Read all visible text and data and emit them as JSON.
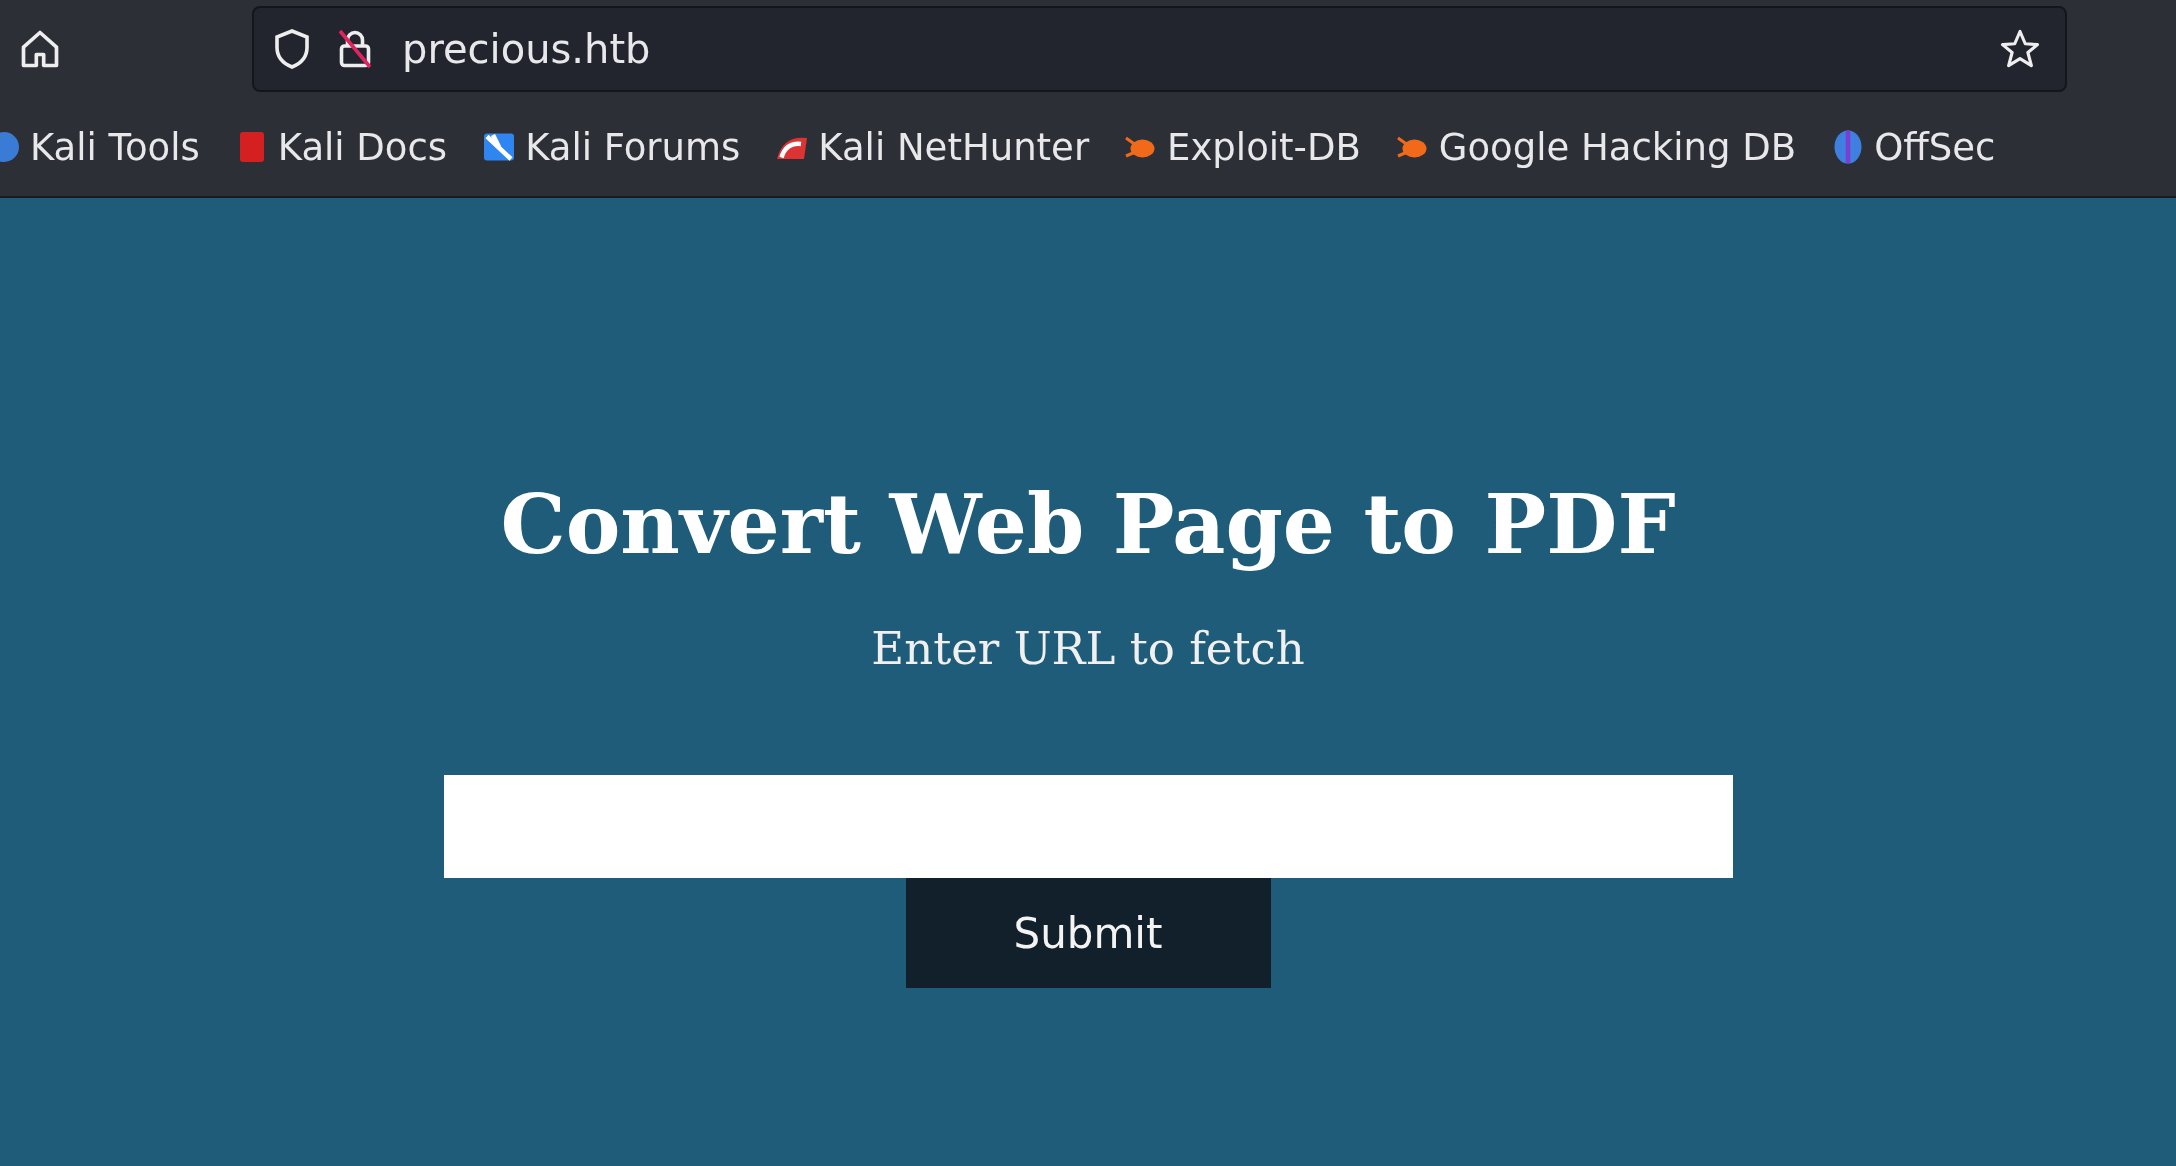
{
  "address_bar": {
    "url": "precious.htb"
  },
  "bookmarks": [
    {
      "label": "Kali Tools"
    },
    {
      "label": "Kali Docs"
    },
    {
      "label": "Kali Forums"
    },
    {
      "label": "Kali NetHunter"
    },
    {
      "label": "Exploit-DB"
    },
    {
      "label": "Google Hacking DB"
    },
    {
      "label": "OffSec"
    }
  ],
  "page": {
    "title": "Convert Web Page to PDF",
    "subtitle": "Enter URL to fetch",
    "submit_button": "Submit"
  }
}
